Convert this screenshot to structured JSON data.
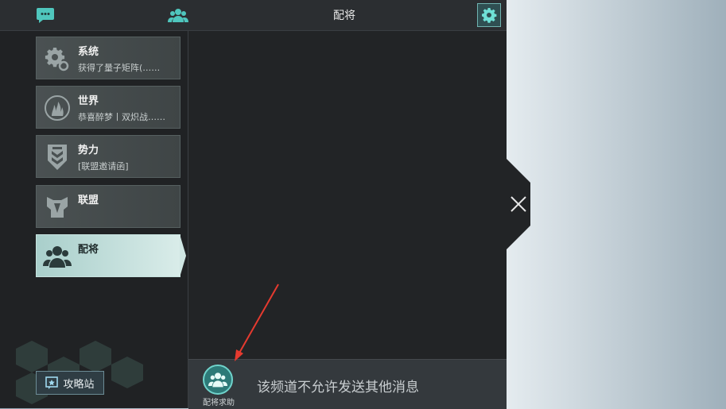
{
  "header": {
    "title": "配将",
    "chat_icon": "chat-bubble-icon",
    "friends_icon": "friends-icon",
    "settings_icon": "gear-icon"
  },
  "channels": [
    {
      "name": "系统",
      "preview": "获得了量子矩阵(……",
      "icon": "gears-icon",
      "active": false
    },
    {
      "name": "世界",
      "preview": "恭喜醉梦丨双炽战……",
      "icon": "flame-icon",
      "active": false
    },
    {
      "name": "势力",
      "preview": "[联盟邀请函]",
      "icon": "shield-chevron-icon",
      "active": false
    },
    {
      "name": "联盟",
      "preview": "",
      "icon": "alliance-icon",
      "active": false
    },
    {
      "name": "配将",
      "preview": "",
      "icon": "team-icon",
      "active": true
    }
  ],
  "guide_button": {
    "label": "攻略站",
    "icon": "guide-book-icon"
  },
  "bottom": {
    "help_label": "配将求助",
    "help_icon": "team-help-icon",
    "notice": "该频道不允许发送其他消息"
  },
  "close_icon": "close-icon",
  "colors": {
    "accent": "#6fd3cb",
    "panel": "#222426",
    "active_tab": "#cfe6e3",
    "arrow": "#e53a2f"
  }
}
